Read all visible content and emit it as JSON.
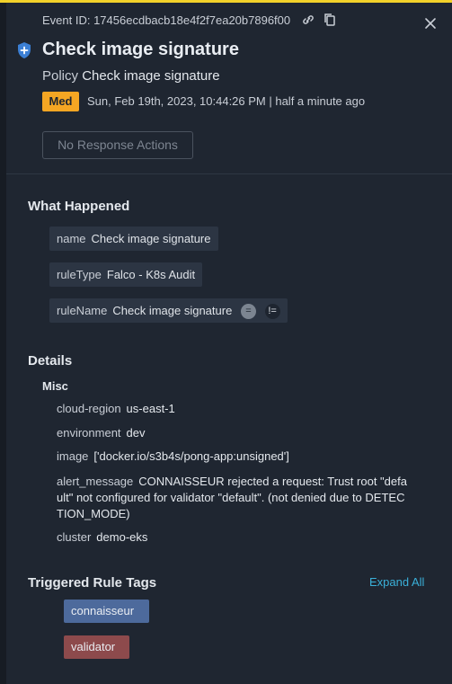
{
  "header": {
    "event_id": "Event ID: 17456ecdbacb18e4f2f7ea20b7896f00",
    "title": "Check image signature",
    "policy_label": "Policy",
    "policy_name": "Check image signature",
    "severity": "Med",
    "timestamp": "Sun, Feb 19th, 2023, 10:44:26 PM | half a minute ago",
    "response_button": "No Response Actions"
  },
  "what_happened": {
    "heading": "What Happened",
    "items": [
      {
        "key": "name",
        "value": "Check image signature"
      },
      {
        "key": "ruleType",
        "value": "Falco - K8s Audit"
      },
      {
        "key": "ruleName",
        "value": "Check image signature",
        "eq": "=",
        "ne": "!="
      }
    ]
  },
  "details": {
    "heading": "Details",
    "misc_heading": "Misc",
    "items": [
      {
        "key": "cloud-region",
        "value": "us-east-1"
      },
      {
        "key": "environment",
        "value": "dev"
      },
      {
        "key": "image",
        "value": "['docker.io/s3b4s/pong-app:unsigned']"
      },
      {
        "key": "alert_message",
        "value": "CONNAISSEUR rejected a request: Trust root \"default\" not configured for validator \"default\". (not denied due to DETECTION_MODE)"
      },
      {
        "key": "cluster",
        "value": "demo-eks"
      }
    ]
  },
  "tags": {
    "heading": "Triggered Rule Tags",
    "expand_all": "Expand All",
    "items": [
      "connaisseur",
      "validator"
    ]
  },
  "icons": {
    "link": "link-icon",
    "copy": "copy-icon",
    "close": "close-icon",
    "shield": "shield-plus-icon"
  },
  "colors": {
    "accent_top": "#f2d12a",
    "severity_med": "#f5a623",
    "link": "#3ab0d9",
    "tag_blue": "#4d6a9c",
    "tag_red": "#8d4a4c"
  }
}
